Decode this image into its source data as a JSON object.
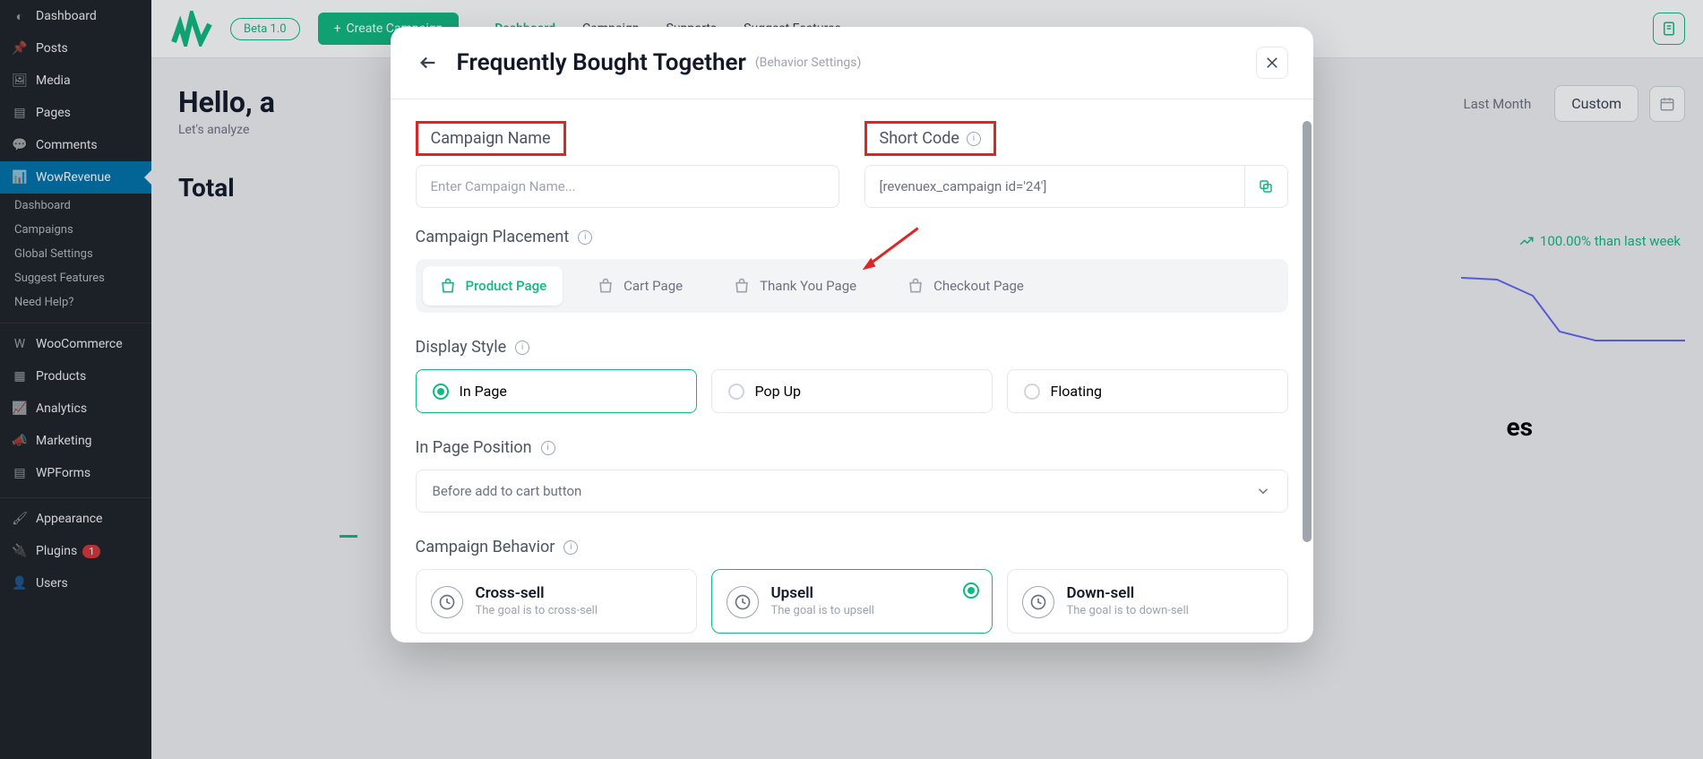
{
  "wp_sidebar": {
    "items": [
      {
        "icon": "dashboard",
        "label": "Dashboard"
      },
      {
        "icon": "pin",
        "label": "Posts"
      },
      {
        "icon": "media",
        "label": "Media"
      },
      {
        "icon": "page",
        "label": "Pages"
      },
      {
        "icon": "comment",
        "label": "Comments"
      },
      {
        "icon": "chart",
        "label": "WowRevenue",
        "active": true
      }
    ],
    "subitems": [
      "Dashboard",
      "Campaigns",
      "Global Settings",
      "Suggest Features",
      "Need Help?"
    ],
    "items2": [
      {
        "icon": "woo",
        "label": "WooCommerce"
      },
      {
        "icon": "products",
        "label": "Products"
      },
      {
        "icon": "analytics",
        "label": "Analytics"
      },
      {
        "icon": "marketing",
        "label": "Marketing"
      },
      {
        "icon": "forms",
        "label": "WPForms"
      }
    ],
    "items3": [
      {
        "icon": "appearance",
        "label": "Appearance"
      },
      {
        "icon": "plugins",
        "label": "Plugins",
        "badge": "1"
      },
      {
        "icon": "users",
        "label": "Users"
      }
    ]
  },
  "topbar": {
    "beta": "Beta 1.0",
    "create": "Create Campaign",
    "nav": [
      "Dashboard",
      "Campaign",
      "Supports",
      "Suggest Features"
    ]
  },
  "hero": {
    "title": "Hello, a",
    "subtitle": "Let's analyze"
  },
  "period": {
    "last_month": "Last Month",
    "custom": "Custom"
  },
  "section": {
    "total": "Total",
    "right": "es"
  },
  "trend": "100.00% than last week",
  "modal": {
    "title": "Frequently Bought Together",
    "subtitle": "(Behavior Settings)",
    "campaign_name_label": "Campaign Name",
    "campaign_name_placeholder": "Enter Campaign Name...",
    "shortcode_label": "Short Code",
    "shortcode_value": "[revenuex_campaign id='24']",
    "placement_label": "Campaign Placement",
    "placements": [
      "Product Page",
      "Cart Page",
      "Thank You Page",
      "Checkout Page"
    ],
    "display_style_label": "Display Style",
    "display_styles": [
      "In Page",
      "Pop Up",
      "Floating"
    ],
    "in_page_position_label": "In Page Position",
    "in_page_position_value": "Before add to cart button",
    "behavior_label": "Campaign Behavior",
    "behaviors": [
      {
        "title": "Cross-sell",
        "desc": "The goal is to cross-sell"
      },
      {
        "title": "Upsell",
        "desc": "The goal is to upsell"
      },
      {
        "title": "Down-sell",
        "desc": "The goal is to down-sell"
      }
    ]
  }
}
